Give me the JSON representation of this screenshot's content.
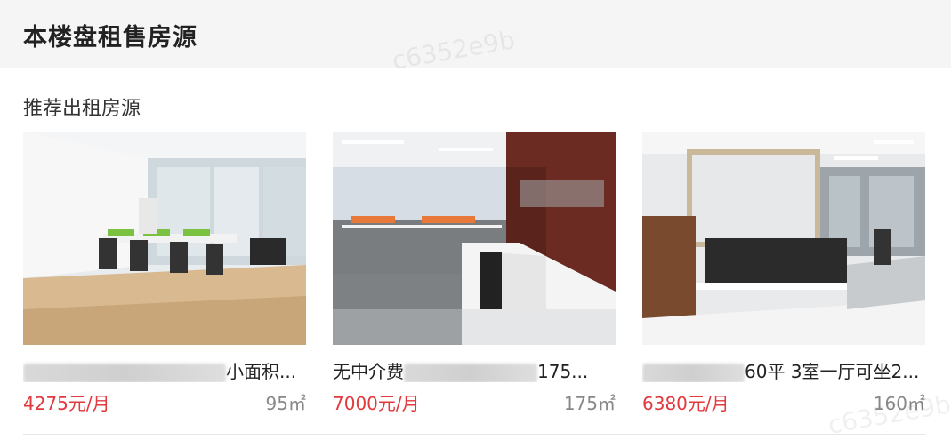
{
  "header": {
    "title": "本楼盘租售房源"
  },
  "section": {
    "title": "推荐出租房源"
  },
  "listings": [
    {
      "title_visible": "小面积...",
      "price": "4275元/月",
      "area": "95㎡"
    },
    {
      "title_visible_start": "无中介费",
      "title_visible_end": "175...",
      "price": "7000元/月",
      "area": "175㎡"
    },
    {
      "title_visible": "60平 3室一厅可坐2...",
      "price": "6380元/月",
      "area": "160㎡"
    }
  ],
  "watermark": {
    "text": "c6352e9b"
  }
}
